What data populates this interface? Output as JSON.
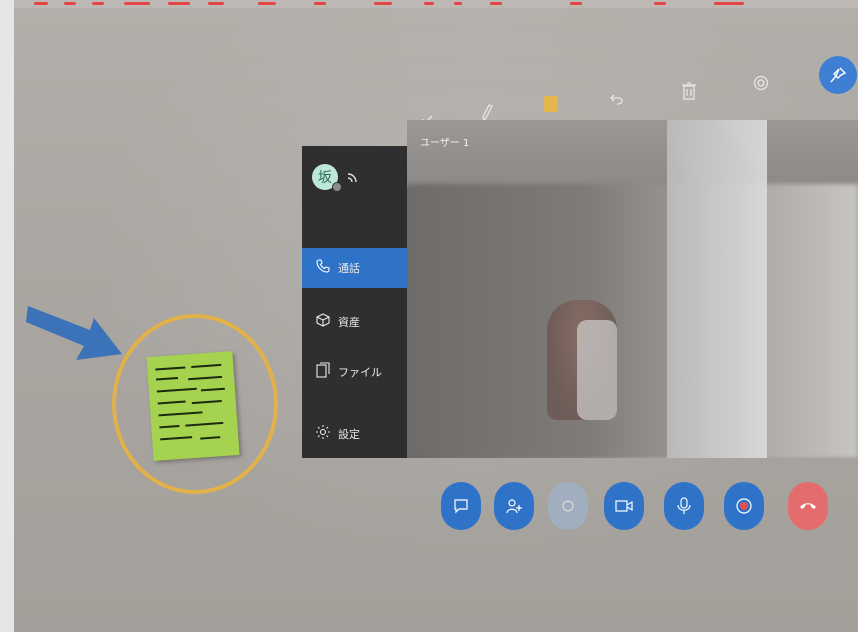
{
  "toolbar": {
    "icons": [
      "arrow-icon",
      "pen-icon",
      "color-swatch",
      "undo-icon",
      "trash-icon",
      "settings-icon",
      "pin-icon"
    ],
    "color_chip": "#e6b84c"
  },
  "sidebar": {
    "avatar_text": "坂",
    "items": [
      {
        "label": "通話",
        "icon": "phone-icon",
        "active": true
      },
      {
        "label": "資産",
        "icon": "cube-icon"
      },
      {
        "label": "ファイル",
        "icon": "file-icon"
      },
      {
        "label": "設定",
        "icon": "gear-icon"
      }
    ]
  },
  "video": {
    "user_label": "ユーザー 1"
  },
  "controls": [
    "chat-icon",
    "add-participant-icon",
    "disabled-control",
    "video-icon",
    "mic-icon",
    "record-icon",
    "hangup-icon"
  ],
  "colors": {
    "accent": "#2f73c9",
    "hangup": "#e56c6c",
    "annotation_circle": "#e3b14a",
    "arrow": "#3c73b8",
    "sticky_note": "#a5d24f"
  }
}
